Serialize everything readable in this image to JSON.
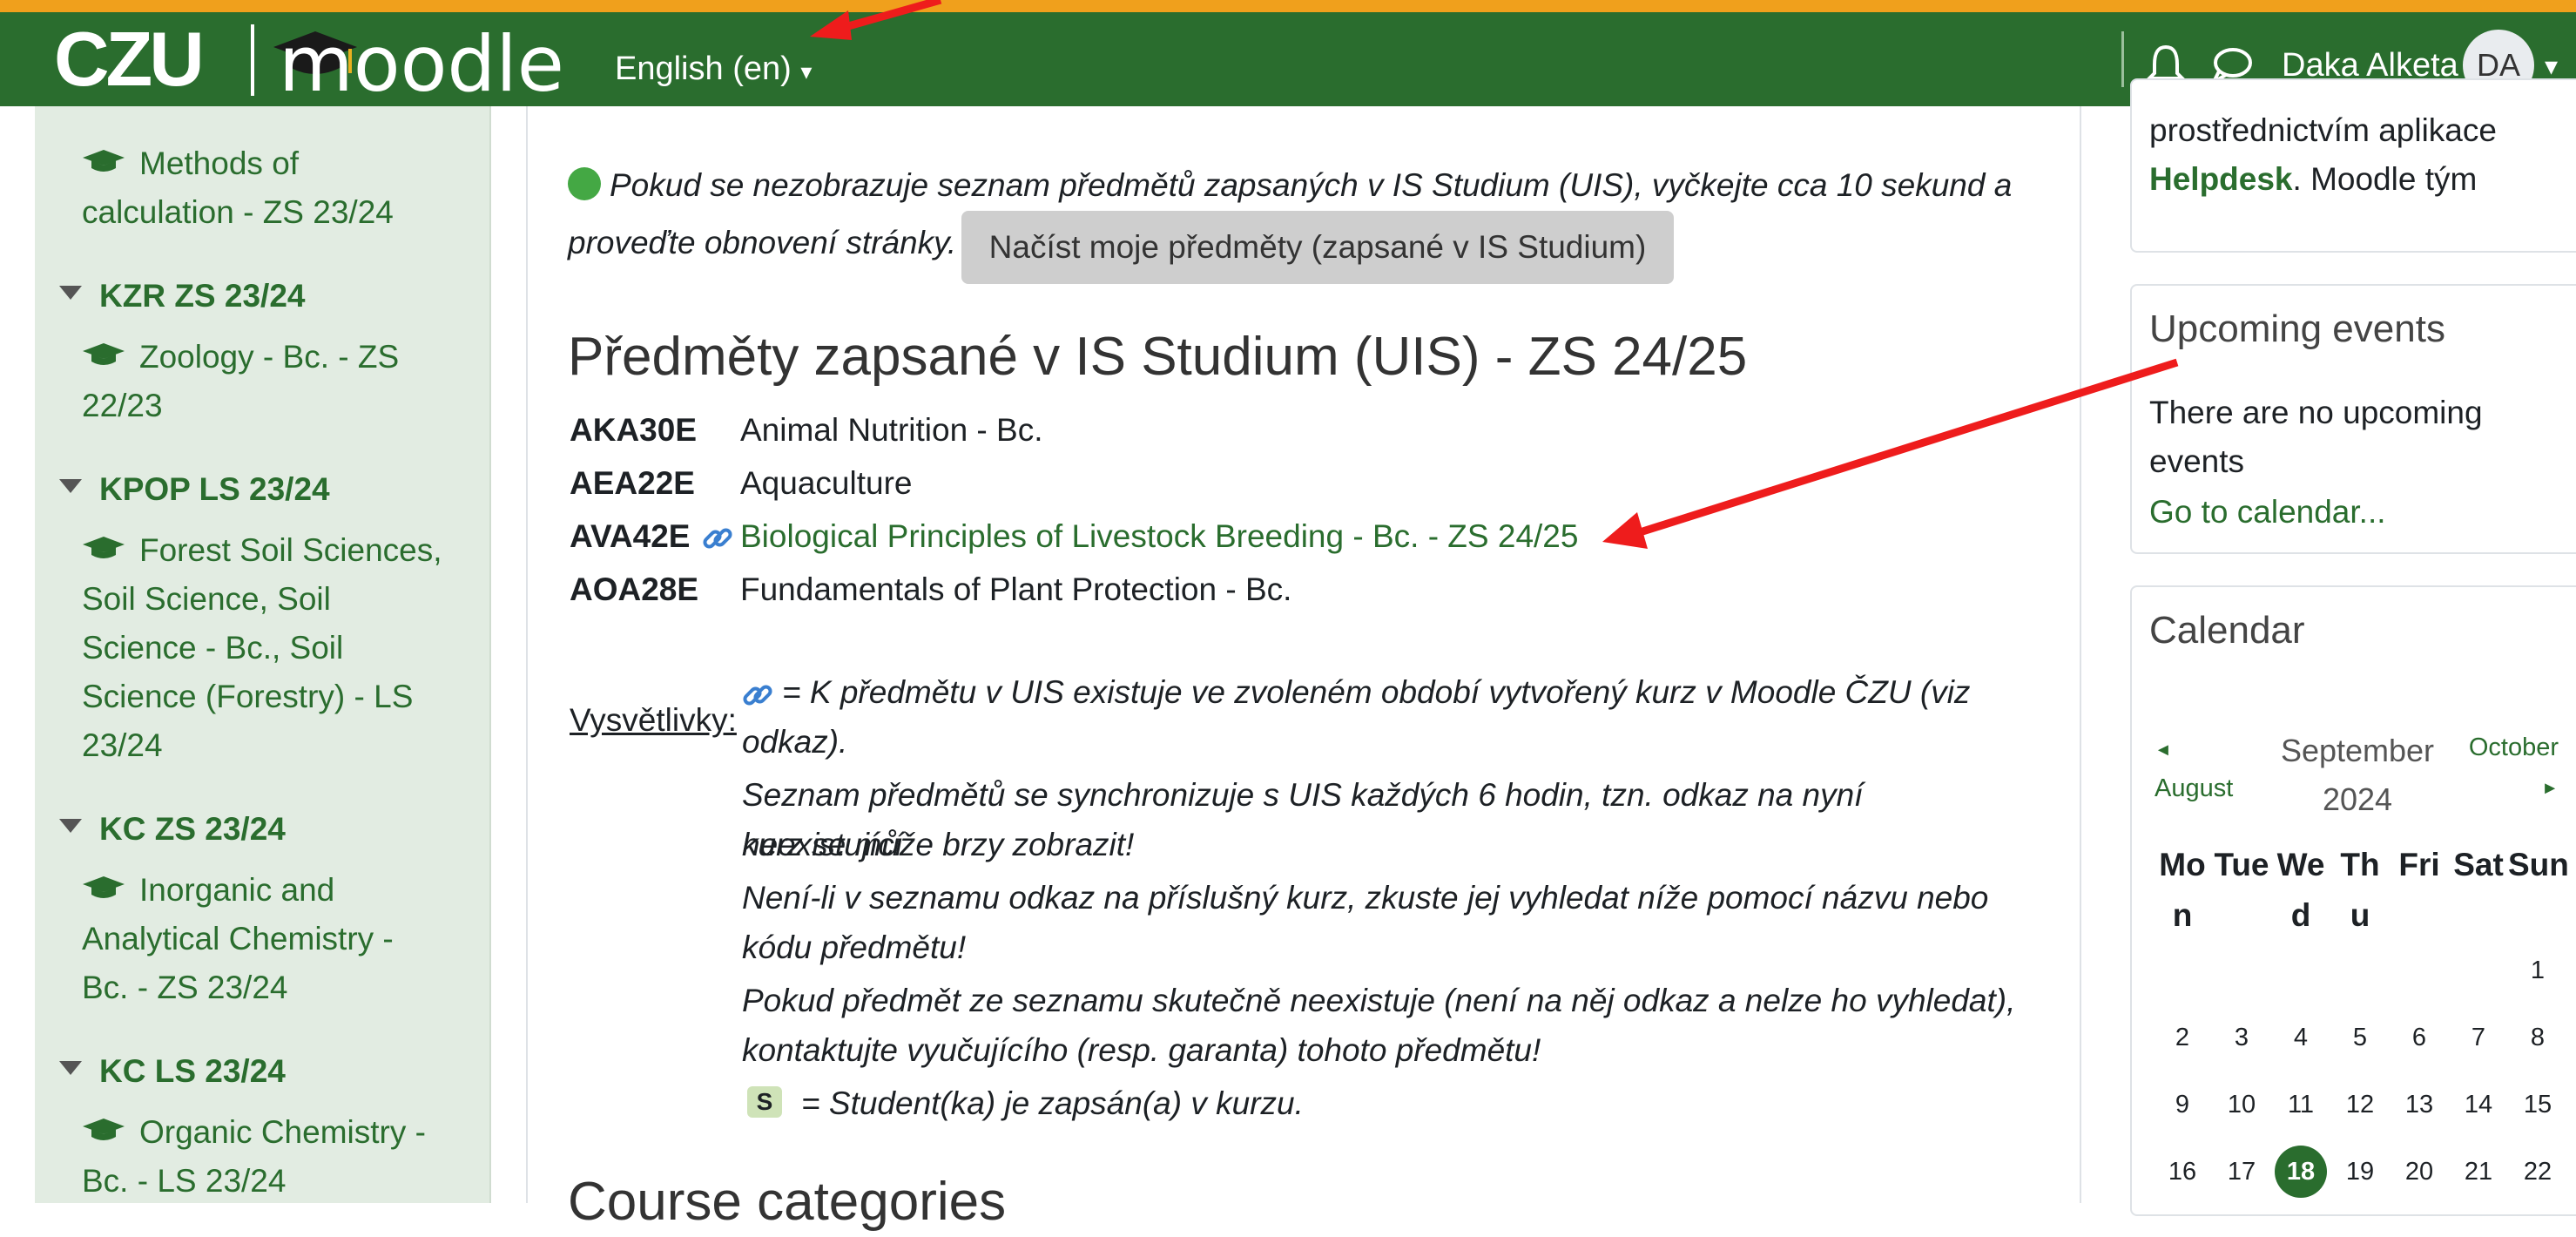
{
  "header": {
    "brand": "CZU",
    "product": "moodle",
    "language": "English (en)",
    "user_name": "Daka Alketa",
    "avatar_initials": "DA"
  },
  "sidebar": {
    "items": [
      {
        "type": "course",
        "lines": [
          "Methods of",
          "calculation - ZS 23/24"
        ]
      },
      {
        "type": "category",
        "label": "KZR ZS 23/24"
      },
      {
        "type": "course",
        "lines": [
          "Zoology - Bc. - ZS",
          "22/23"
        ]
      },
      {
        "type": "category",
        "label": "KPOP LS 23/24"
      },
      {
        "type": "course",
        "lines": [
          "Forest Soil Sciences,",
          "Soil Science, Soil",
          "Science - Bc., Soil",
          "Science (Forestry) - LS",
          "23/24"
        ]
      },
      {
        "type": "category",
        "label": "KC ZS 23/24"
      },
      {
        "type": "course",
        "lines": [
          "Inorganic and",
          "Analytical Chemistry -",
          "Bc. - ZS 23/24"
        ]
      },
      {
        "type": "category",
        "label": "KC LS 23/24"
      },
      {
        "type": "course",
        "lines": [
          "Organic Chemistry -",
          "Bc. - LS 23/24"
        ]
      }
    ]
  },
  "main": {
    "notice_line1": "Pokud se nezobrazuje seznam předmětů zapsaných v IS Studium (UIS), vyčkejte cca 10 sekund a",
    "notice_line2": "proveďte obnovení stránky.",
    "load_button": "Načíst moje předměty (zapsané v IS Studium)",
    "section_title": "Předměty zapsané v IS Studium (UIS) - ZS 24/25",
    "courses": [
      {
        "code": "AKA30E",
        "name": "Animal Nutrition - Bc.",
        "linked": false
      },
      {
        "code": "AEA22E",
        "name": "Aquaculture",
        "linked": false
      },
      {
        "code": "AVA42E",
        "name": "Biological Principles of Livestock Breeding - Bc. - ZS 24/25",
        "linked": true
      },
      {
        "code": "AOA28E",
        "name": "Fundamentals of Plant Protection - Bc.",
        "linked": false
      }
    ],
    "legend_label": "Vysvětlivky:",
    "legend_lines": [
      "= K předmětu v UIS existuje ve zvoleném období vytvořený kurz v Moodle ČZU (viz",
      "odkaz).",
      "Seznam předmětů se synchronizuje s UIS každých 6 hodin, tzn. odkaz na nyní neexistující",
      "kurz se může brzy zobrazit!",
      "Není-li v seznamu odkaz na příslušný kurz, zkuste jej vyhledat níže pomocí názvu nebo",
      "kódu předmětu!",
      "Pokud předmět ze seznamu skutečně neexistuje (není na něj odkaz a nelze ho vyhledat),",
      "kontaktujte vyučujícího (resp. garanta) tohoto předmětu!"
    ],
    "s_badge": "S",
    "s_legend": "= Student(ka) je zapsán(a) v kurzu.",
    "categories_title": "Course categories"
  },
  "right": {
    "helpdesk_text_1": "prostřednictvím aplikace",
    "helpdesk_link": "Helpdesk",
    "helpdesk_text_2": ". Moodle tým",
    "upcoming_title": "Upcoming events",
    "no_events_1": "There are no upcoming",
    "no_events_2": "events",
    "go_calendar": "Go to calendar...",
    "calendar_title": "Calendar",
    "prev_month": "August",
    "current_month_1": "September",
    "current_month_2": "2024",
    "next_month": "October",
    "prev_arrow": "◄",
    "next_arrow": "►",
    "dow": [
      {
        "a": "Mo",
        "b": "n"
      },
      {
        "a": "Tue",
        "b": ""
      },
      {
        "a": "We",
        "b": "d"
      },
      {
        "a": "Th",
        "b": "u"
      },
      {
        "a": "Fri",
        "b": ""
      },
      {
        "a": "Sat",
        "b": ""
      },
      {
        "a": "Sun",
        "b": ""
      }
    ],
    "weeks": [
      [
        "",
        "",
        "",
        "",
        "",
        "",
        "1"
      ],
      [
        "2",
        "3",
        "4",
        "5",
        "6",
        "7",
        "8"
      ],
      [
        "9",
        "10",
        "11",
        "12",
        "13",
        "14",
        "15"
      ],
      [
        "16",
        "17",
        "18",
        "19",
        "20",
        "21",
        "22"
      ]
    ],
    "today": "18"
  },
  "colors": {
    "navbar": "#2a6d2e",
    "accent_stripe": "#f0a01c",
    "link": "#2a6d2e",
    "annotation_arrow": "#ee1c1c"
  }
}
